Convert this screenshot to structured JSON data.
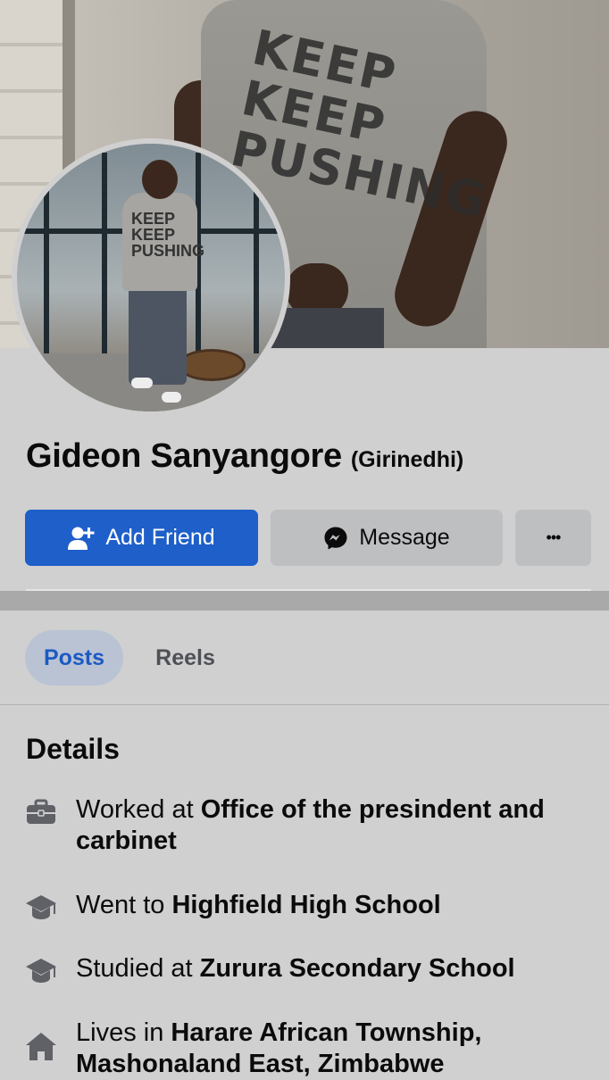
{
  "profile": {
    "name": "Gideon Sanyangore",
    "alternate_name": "(Girinedhi)",
    "cover_shirt_text": "KEEP KEEP PUSHING",
    "avatar_shirt_text": "KEEP KEEP PUSHING"
  },
  "actions": {
    "add_friend": "Add Friend",
    "message": "Message",
    "more": "•••"
  },
  "tabs": [
    {
      "label": "Posts",
      "selected": true
    },
    {
      "label": "Reels",
      "selected": false
    }
  ],
  "details": {
    "title": "Details",
    "items": [
      {
        "icon": "briefcase-icon",
        "prefix": "Worked at",
        "value": "Office of the presindent and carbinet"
      },
      {
        "icon": "graduation-cap-icon",
        "prefix": "Went to",
        "value": "Highfield High School"
      },
      {
        "icon": "graduation-cap-icon",
        "prefix": "Studied at",
        "value": "Zurura Secondary School"
      },
      {
        "icon": "home-icon",
        "prefix": "Lives in",
        "value": "Harare African Township, Mashonaland East, Zimbabwe"
      }
    ]
  },
  "colors": {
    "primary": "#1e5fc9",
    "background": "#d0d0d1",
    "secondary_button": "#bebfc1",
    "tab_selected_bg": "#b9c3d4",
    "tab_selected_text": "#1c5ac3"
  }
}
